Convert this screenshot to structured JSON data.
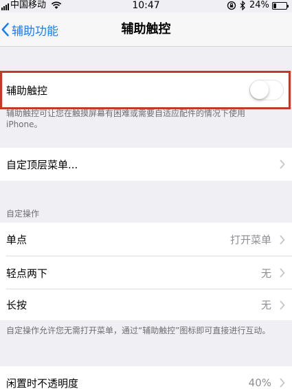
{
  "status_bar": {
    "carrier": "中国移动",
    "time": "10:47",
    "battery_percent": "24%",
    "battery_level": 0.24,
    "icons": [
      "signal-icon",
      "wifi-icon",
      "rotation-lock-icon",
      "bluetooth-icon",
      "battery-icon"
    ]
  },
  "nav": {
    "back_label": "辅助功能",
    "title": "辅助触控"
  },
  "assistive_touch": {
    "label": "辅助触控",
    "enabled": false,
    "footnote": "辅助触控可让您在触摸屏幕有困难或需要自适应配件的情况下使用 iPhone。"
  },
  "customize_menu": {
    "label": "自定顶层菜单..."
  },
  "custom_actions": {
    "header": "自定操作",
    "rows": [
      {
        "label": "单点",
        "value": "打开菜单"
      },
      {
        "label": "轻点两下",
        "value": "无"
      },
      {
        "label": "长按",
        "value": "无"
      }
    ],
    "footnote": "自定操作允许您无需打开菜单，通过“辅助触控”图标即可直接进行互动。"
  },
  "idle_opacity": {
    "label": "闲置时不透明度",
    "value": "40%"
  },
  "colors": {
    "accent": "#157efb",
    "highlight_border": "#c0392b",
    "background": "#efeff4"
  }
}
